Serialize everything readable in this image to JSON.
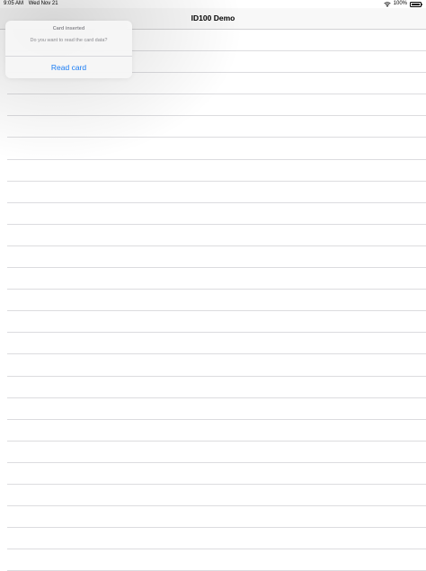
{
  "status_bar": {
    "time": "9:05 AM",
    "date": "Wed Nov 21",
    "battery": "100%"
  },
  "nav": {
    "title": "ID100 Demo"
  },
  "table": {
    "row_count": 25
  },
  "alert": {
    "title": "Card inserted",
    "message": "Do you want to read the card data?",
    "action_label": "Read card",
    "action_color": "#1a7cf4"
  }
}
